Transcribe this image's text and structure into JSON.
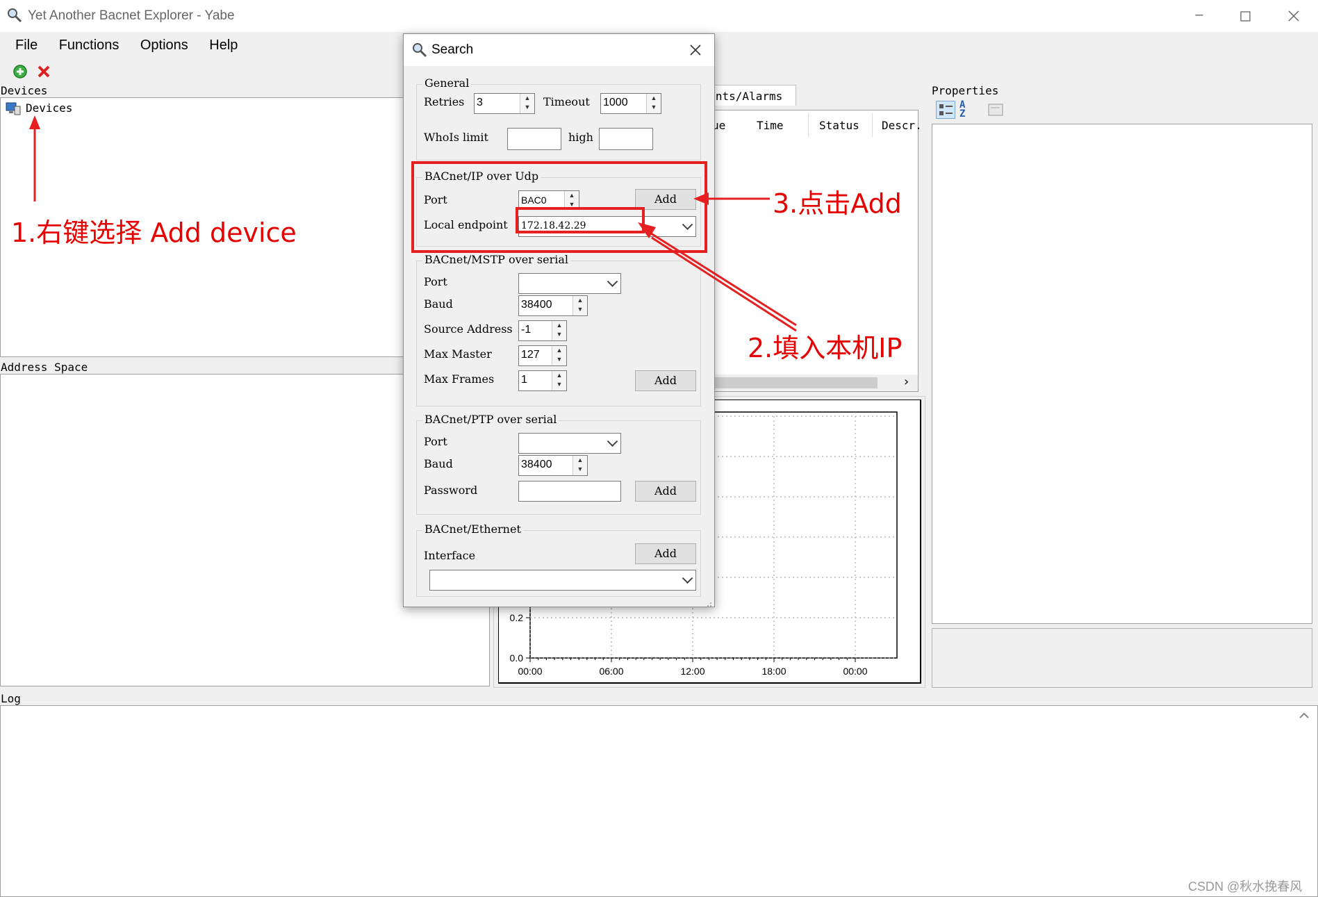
{
  "window": {
    "title": "Yet Another Bacnet Explorer - Yabe"
  },
  "menu": [
    "File",
    "Functions",
    "Options",
    "Help"
  ],
  "toolbar": {
    "add_icon": "add-icon",
    "remove_icon": "remove-icon"
  },
  "devices": {
    "title": "Devices",
    "root": "Devices"
  },
  "address_space": {
    "title": "Address Space"
  },
  "events": {
    "tab_label": "Events/Alarms",
    "columns": [
      "ue",
      "Time",
      "Status",
      "Descr."
    ]
  },
  "properties": {
    "title": "Properties"
  },
  "chart_data": {
    "type": "line",
    "x_tick_labels": [
      "00:00",
      "06:00",
      "12:00",
      "18:00",
      "00:00"
    ],
    "y_tick_labels": [
      "0.0",
      "0.2"
    ],
    "series": []
  },
  "log": {
    "title": "Log"
  },
  "dialog": {
    "title": "Search",
    "general": {
      "title": "General",
      "retries_label": "Retries",
      "retries_value": "3",
      "timeout_label": "Timeout",
      "timeout_value": "1000",
      "whois_label": "WhoIs limit",
      "whois_low": "",
      "whois_high_label": "high",
      "whois_high": ""
    },
    "bacnet_ip": {
      "title": "BACnet/IP over Udp",
      "port_label": "Port",
      "port_value": "BAC0",
      "endpoint_label": "Local endpoint",
      "endpoint_value": "172.18.42.29",
      "add_label": "Add"
    },
    "mstp": {
      "title": "BACnet/MSTP over serial",
      "port_label": "Port",
      "port_value": "",
      "baud_label": "Baud",
      "baud_value": "38400",
      "source_label": "Source Address",
      "source_value": "-1",
      "master_label": "Max Master",
      "master_value": "127",
      "frames_label": "Max Frames",
      "frames_value": "1",
      "add_label": "Add"
    },
    "ptp": {
      "title": "BACnet/PTP over serial",
      "port_label": "Port",
      "port_value": "",
      "baud_label": "Baud",
      "baud_value": "38400",
      "password_label": "Password",
      "password_value": "",
      "add_label": "Add"
    },
    "ethernet": {
      "title": "BACnet/Ethernet",
      "interface_label": "Interface",
      "interface_value": "",
      "add_label": "Add"
    }
  },
  "annotations": {
    "step1": "1.右键选择 Add device",
    "step2": "2.填入本机IP",
    "step3": "3.点击Add"
  },
  "watermark": "CSDN @秋水挽春风"
}
